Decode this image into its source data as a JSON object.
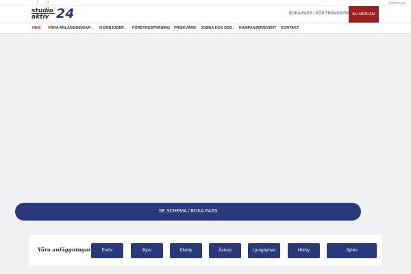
{
  "topbar": {
    "social": [
      {
        "icon": "facebook-icon",
        "glyph": "f"
      },
      {
        "icon": "instagram-icon",
        "glyph": "◘"
      }
    ],
    "login_label": "LOGGA IN"
  },
  "header": {
    "logo": {
      "line1": "studio",
      "line2": "aktiv",
      "number": "24"
    },
    "boka_link": "BOKA PASS - KÖP TRÄNINGSKORT",
    "cta_label": "BLI MEDLEM",
    "cta_color": "#9b2121"
  },
  "nav": {
    "items": [
      {
        "label": "HEM",
        "active": true,
        "dropdown": false
      },
      {
        "label": "VÅRA ANLÄGGNINGAR",
        "active": false,
        "dropdown": true
      },
      {
        "label": "VI ERBJUDER",
        "active": false,
        "dropdown": true
      },
      {
        "label": "FÖRETAGSTRÄNING",
        "active": false,
        "dropdown": false
      },
      {
        "label": "FRISKVÅRD",
        "active": false,
        "dropdown": false
      },
      {
        "label": "JOBBA HOS OSS",
        "active": false,
        "dropdown": true
      },
      {
        "label": "KAMPANJER/EVENT",
        "active": false,
        "dropdown": false
      },
      {
        "label": "KONTAKT",
        "active": false,
        "dropdown": false
      }
    ],
    "caret_glyph": "⌄",
    "active_color": "#9b2121"
  },
  "schema_button": {
    "label": "SE SCHEMA / BOKA PASS",
    "color": "#283a7b"
  },
  "locations": {
    "title": "Våra anläggningar:",
    "buttons": [
      "Eslöv",
      "Bjuv",
      "Ekeby",
      "Åstorp",
      "Ljungbyhed",
      "Hörby",
      "Sjöbo"
    ]
  }
}
